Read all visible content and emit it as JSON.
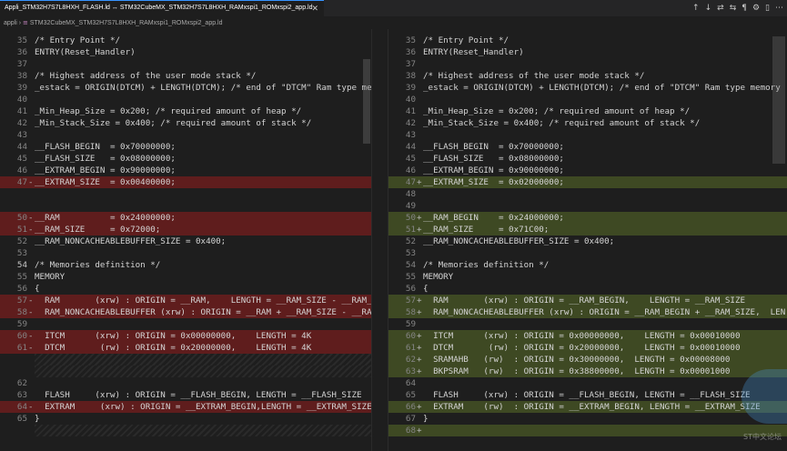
{
  "tab": {
    "title": "Appli_STM32H7S7L8HXH_FLASH.ld ↔ STM32CubeMX_STM32H7S7L8HXH_RAMxspi1_ROMxspi2_app.ld",
    "close_icon": "close-icon"
  },
  "actions": [
    "↑",
    "↓",
    "⇄",
    "⇆",
    "¶",
    "⚙",
    "▯",
    "⋯"
  ],
  "breadcrumb": {
    "folder": "appli",
    "file": "STM32CubeMX_STM32H7S7L8HXH_RAMxspi1_ROMxspi2_app.ld"
  },
  "left": {
    "lines": [
      {
        "n": "35",
        "k": "n",
        "t": "/* Entry Point */"
      },
      {
        "n": "36",
        "k": "n",
        "t": "ENTRY(Reset_Handler)"
      },
      {
        "n": "37",
        "k": "n",
        "t": ""
      },
      {
        "n": "38",
        "k": "n",
        "t": "/* Highest address of the user mode stack */"
      },
      {
        "n": "39",
        "k": "n",
        "t": "_estack = ORIGIN(DTCM) + LENGTH(DTCM); /* end of \"DTCM\" Ram type memo"
      },
      {
        "n": "40",
        "k": "n",
        "t": ""
      },
      {
        "n": "41",
        "k": "n",
        "t": "_Min_Heap_Size = 0x200; /* required amount of heap */"
      },
      {
        "n": "42",
        "k": "n",
        "t": "_Min_Stack_Size = 0x400; /* required amount of stack */"
      },
      {
        "n": "43",
        "k": "n",
        "t": ""
      },
      {
        "n": "44",
        "k": "n",
        "t": "__FLASH_BEGIN  = 0x70000000;"
      },
      {
        "n": "45",
        "k": "n",
        "t": "__FLASH_SIZE   = 0x08000000;"
      },
      {
        "n": "46",
        "k": "n",
        "t": "__EXTRAM_BEGIN = 0x90000000;"
      },
      {
        "n": "47",
        "k": "d",
        "m": "-",
        "t": "__EXTRAM_SIZE  = 0x00400000;"
      },
      {
        "n": "",
        "k": "g",
        "t": ""
      },
      {
        "n": "",
        "k": "g",
        "t": ""
      },
      {
        "n": "50",
        "k": "d",
        "m": "-",
        "t": "__RAM          = 0x24000000;"
      },
      {
        "n": "51",
        "k": "d",
        "m": "-",
        "t": "__RAM_SIZE     = 0x72000;"
      },
      {
        "n": "52",
        "k": "n",
        "t": "__RAM_NONCACHEABLEBUFFER_SIZE = 0x400;"
      },
      {
        "n": "53",
        "k": "n",
        "t": ""
      },
      {
        "n": "54",
        "k": "n",
        "c": "1",
        "t": "/* Memories definition */"
      },
      {
        "n": "55",
        "k": "n",
        "t": "MEMORY"
      },
      {
        "n": "56",
        "k": "n",
        "t": "{"
      },
      {
        "n": "57",
        "k": "d",
        "m": "-",
        "t": "  RAM       (xrw) : ORIGIN = __RAM,    LENGTH = __RAM_SIZE - __RAM_NO"
      },
      {
        "n": "58",
        "k": "d",
        "m": "-",
        "t": "  RAM_NONCACHEABLEBUFFER (xrw) : ORIGIN = __RAM + __RAM_SIZE - __RAM_"
      },
      {
        "n": "59",
        "k": "n",
        "t": ""
      },
      {
        "n": "60",
        "k": "d",
        "m": "-",
        "t": "  ITCM      (xrw) : ORIGIN = 0x00000000,    LENGTH = 4K"
      },
      {
        "n": "61",
        "k": "d",
        "m": "-",
        "t": "  DTCM       (rw) : ORIGIN = 0x20000000,    LENGTH = 4K"
      },
      {
        "n": "",
        "k": "h",
        "t": ""
      },
      {
        "n": "",
        "k": "h",
        "t": ""
      },
      {
        "n": "62",
        "k": "n",
        "t": ""
      },
      {
        "n": "63",
        "k": "n",
        "t": "  FLASH     (xrw) : ORIGIN = __FLASH_BEGIN, LENGTH = __FLASH_SIZE"
      },
      {
        "n": "64",
        "k": "d",
        "m": "-",
        "t": "  EXTRAM     (xrw) : ORIGIN = __EXTRAM_BEGIN,LENGTH = __EXTRAM_SIZE"
      },
      {
        "n": "65",
        "k": "n",
        "t": "}"
      },
      {
        "n": "",
        "k": "h",
        "t": ""
      }
    ]
  },
  "right": {
    "lines": [
      {
        "n": "35",
        "k": "n",
        "t": "/* Entry Point */"
      },
      {
        "n": "36",
        "k": "n",
        "t": "ENTRY(Reset_Handler)"
      },
      {
        "n": "37",
        "k": "n",
        "t": ""
      },
      {
        "n": "38",
        "k": "n",
        "t": "/* Highest address of the user mode stack */"
      },
      {
        "n": "39",
        "k": "n",
        "t": "_estack = ORIGIN(DTCM) + LENGTH(DTCM); /* end of \"DTCM\" Ram type memory"
      },
      {
        "n": "40",
        "k": "n",
        "t": ""
      },
      {
        "n": "41",
        "k": "n",
        "t": "_Min_Heap_Size = 0x200; /* required amount of heap */"
      },
      {
        "n": "42",
        "k": "n",
        "t": "_Min_Stack_Size = 0x400; /* required amount of stack */"
      },
      {
        "n": "43",
        "k": "n",
        "t": ""
      },
      {
        "n": "44",
        "k": "n",
        "t": "__FLASH_BEGIN  = 0x70000000;"
      },
      {
        "n": "45",
        "k": "n",
        "t": "__FLASH_SIZE   = 0x08000000;"
      },
      {
        "n": "46",
        "k": "n",
        "t": "__EXTRAM_BEGIN = 0x90000000;"
      },
      {
        "n": "47",
        "k": "i",
        "m": "+",
        "t": "__EXTRAM_SIZE  = 0x02000000;"
      },
      {
        "n": "48",
        "k": "n",
        "t": ""
      },
      {
        "n": "49",
        "k": "n",
        "t": ""
      },
      {
        "n": "50",
        "k": "i",
        "m": "+",
        "t": "__RAM_BEGIN    = 0x24000000;"
      },
      {
        "n": "51",
        "k": "i",
        "m": "+",
        "t": "__RAM_SIZE     = 0x71C00;"
      },
      {
        "n": "52",
        "k": "n",
        "t": "__RAM_NONCACHEABLEBUFFER_SIZE = 0x400;"
      },
      {
        "n": "53",
        "k": "n",
        "t": ""
      },
      {
        "n": "54",
        "k": "n",
        "t": "/* Memories definition */"
      },
      {
        "n": "55",
        "k": "n",
        "t": "MEMORY"
      },
      {
        "n": "56",
        "k": "n",
        "t": "{"
      },
      {
        "n": "57",
        "k": "i",
        "m": "+",
        "t": "  RAM       (xrw) : ORIGIN = __RAM_BEGIN,    LENGTH = __RAM_SIZE"
      },
      {
        "n": "58",
        "k": "i",
        "m": "+",
        "t": "  RAM_NONCACHEABLEBUFFER (xrw) : ORIGIN = __RAM_BEGIN + __RAM_SIZE,  LEN"
      },
      {
        "n": "59",
        "k": "n",
        "t": ""
      },
      {
        "n": "60",
        "k": "i",
        "m": "+",
        "t": "  ITCM      (xrw) : ORIGIN = 0x00000000,    LENGTH = 0x00010000"
      },
      {
        "n": "61",
        "k": "i",
        "m": "+",
        "t": "  DTCM       (rw) : ORIGIN = 0x20000000,    LENGTH = 0x00010000"
      },
      {
        "n": "62",
        "k": "i",
        "m": "+",
        "t": "  SRAMAHB   (rw)  : ORIGIN = 0x30000000,  LENGTH = 0x00008000"
      },
      {
        "n": "63",
        "k": "i",
        "m": "+",
        "t": "  BKPSRAM   (rw)  : ORIGIN = 0x38800000,  LENGTH = 0x00001000"
      },
      {
        "n": "64",
        "k": "n",
        "t": ""
      },
      {
        "n": "65",
        "k": "n",
        "t": "  FLASH     (xrw) : ORIGIN = __FLASH_BEGIN, LENGTH = __FLASH_SIZE"
      },
      {
        "n": "66",
        "k": "i",
        "m": "+",
        "t": "  EXTRAM    (rw)  : ORIGIN = __EXTRAM_BEGIN, LENGTH = __EXTRAM_SIZE"
      },
      {
        "n": "67",
        "k": "n",
        "t": "}"
      },
      {
        "n": "68",
        "k": "i",
        "m": "+",
        "t": ""
      }
    ]
  },
  "watermark": "ST中文论坛"
}
